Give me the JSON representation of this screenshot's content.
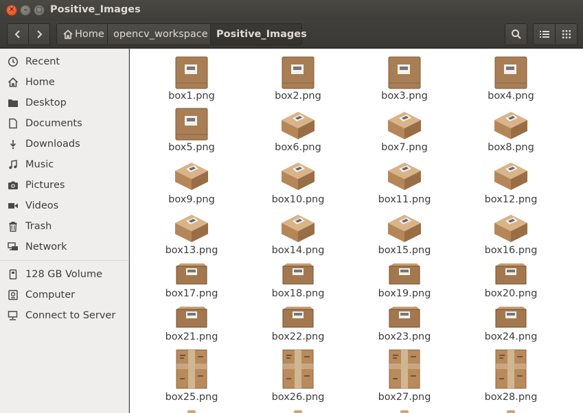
{
  "window": {
    "title": "Positive_Images"
  },
  "toolbar": {
    "back_icon": "chevron-left-icon",
    "forward_icon": "chevron-right-icon",
    "breadcrumbs": [
      {
        "label": "Home",
        "icon": "home-icon"
      },
      {
        "label": "opencv_workspace"
      },
      {
        "label": "Positive_Images"
      }
    ],
    "search_icon": "search-icon",
    "list_view_icon": "list-view-icon",
    "grid_view_icon": "grid-view-icon"
  },
  "sidebar": {
    "places": [
      {
        "label": "Recent",
        "icon": "clock-icon"
      },
      {
        "label": "Home",
        "icon": "home-icon"
      },
      {
        "label": "Desktop",
        "icon": "folder-icon"
      },
      {
        "label": "Documents",
        "icon": "document-icon"
      },
      {
        "label": "Downloads",
        "icon": "download-icon"
      },
      {
        "label": "Music",
        "icon": "music-icon"
      },
      {
        "label": "Pictures",
        "icon": "camera-icon"
      },
      {
        "label": "Videos",
        "icon": "video-icon"
      },
      {
        "label": "Trash",
        "icon": "trash-icon"
      },
      {
        "label": "Network",
        "icon": "network-icon"
      }
    ],
    "devices": [
      {
        "label": "128 GB Volume",
        "icon": "drive-icon"
      },
      {
        "label": "Computer",
        "icon": "computer-icon"
      },
      {
        "label": "Connect to Server",
        "icon": "server-icon"
      }
    ]
  },
  "files": [
    {
      "name": "box1.png",
      "style": "flat"
    },
    {
      "name": "box2.png",
      "style": "flat"
    },
    {
      "name": "box3.png",
      "style": "flat"
    },
    {
      "name": "box4.png",
      "style": "flat"
    },
    {
      "name": "box5.png",
      "style": "flat"
    },
    {
      "name": "box6.png",
      "style": "iso"
    },
    {
      "name": "box7.png",
      "style": "iso"
    },
    {
      "name": "box8.png",
      "style": "iso"
    },
    {
      "name": "box9.png",
      "style": "iso"
    },
    {
      "name": "box10.png",
      "style": "iso"
    },
    {
      "name": "box11.png",
      "style": "iso"
    },
    {
      "name": "box12.png",
      "style": "iso"
    },
    {
      "name": "box13.png",
      "style": "iso"
    },
    {
      "name": "box14.png",
      "style": "iso"
    },
    {
      "name": "box15.png",
      "style": "iso"
    },
    {
      "name": "box16.png",
      "style": "iso"
    },
    {
      "name": "box17.png",
      "style": "side"
    },
    {
      "name": "box18.png",
      "style": "side"
    },
    {
      "name": "box19.png",
      "style": "side"
    },
    {
      "name": "box20.png",
      "style": "side"
    },
    {
      "name": "box21.png",
      "style": "side"
    },
    {
      "name": "box22.png",
      "style": "side"
    },
    {
      "name": "box23.png",
      "style": "side"
    },
    {
      "name": "box24.png",
      "style": "side"
    },
    {
      "name": "box25.png",
      "style": "tall"
    },
    {
      "name": "box26.png",
      "style": "tall"
    },
    {
      "name": "box27.png",
      "style": "tall"
    },
    {
      "name": "box28.png",
      "style": "tall"
    }
  ]
}
